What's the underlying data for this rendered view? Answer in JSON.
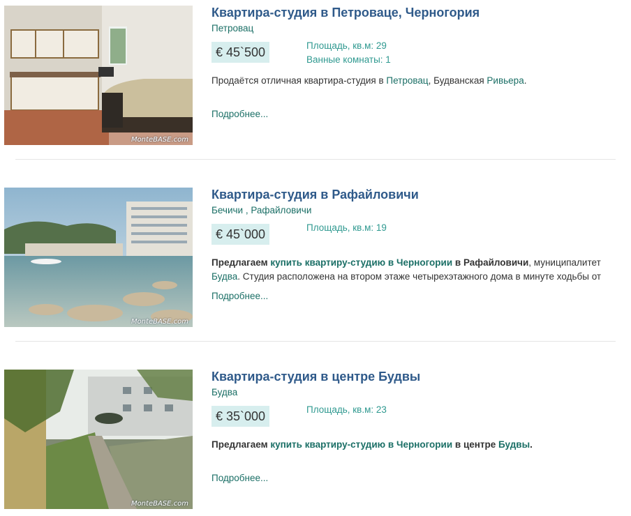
{
  "listings": [
    {
      "title": "Квартира-студия в Петроваце, Черногория",
      "location": "Петровац",
      "price": "€ 45`500",
      "specs": [
        "Площадь, кв.м: 29",
        "Ванные комнаты: 1"
      ],
      "desc_parts": [
        {
          "text": "Продаётся отличная квартира-студия в ",
          "style": "plain"
        },
        {
          "text": "Петровац",
          "style": "link"
        },
        {
          "text": ", ",
          "style": "plain"
        },
        {
          "text": "Будванская",
          "style": "plain"
        },
        {
          "text": " ",
          "style": "plain"
        },
        {
          "text": "Ривьера",
          "style": "link"
        },
        {
          "text": ".",
          "style": "plain"
        }
      ],
      "more": "Подробнее...",
      "watermark": "MonteBASE.com",
      "image_icon": "kitchen-photo"
    },
    {
      "title": "Квартира-студия в Рафайловичи",
      "location": "Бечичи , Рафайловичи",
      "price": "€ 45`000",
      "specs": [
        "Площадь, кв.м: 19"
      ],
      "desc_parts": [
        {
          "text": "Предлагаем ",
          "style": "bold"
        },
        {
          "text": "купить квартиру-студию в Черногории",
          "style": "boldlink"
        },
        {
          "text": " в Рафайловичи",
          "style": "bold"
        },
        {
          "text": ", муниципалитет ",
          "style": "plain"
        },
        {
          "text": "Будва",
          "style": "link"
        },
        {
          "text": ". Студия расположена на втором этаже четырехэтажного дома в минуте ходьбы от",
          "style": "plain"
        }
      ],
      "more": "Подробнее...",
      "watermark": "MonteBASE.com",
      "image_icon": "beach-photo"
    },
    {
      "title": "Квартира-студия в центре Будвы",
      "location": "Будва",
      "price": "€ 35`000",
      "specs": [
        "Площадь, кв.м: 23"
      ],
      "desc_parts": [
        {
          "text": "Предлагаем ",
          "style": "bold"
        },
        {
          "text": "купить квартиру-студию в Черногории",
          "style": "boldlink"
        },
        {
          "text": " в центре ",
          "style": "bold"
        },
        {
          "text": "Будвы",
          "style": "boldlink"
        },
        {
          "text": ".",
          "style": "bold"
        }
      ],
      "more": "Подробнее...",
      "watermark": "MonteBASE.com",
      "image_icon": "yard-photo"
    }
  ],
  "colors": {
    "title": "#2f5a8a",
    "link": "#1b6f66",
    "spec": "#2f9990",
    "price_bg": "#d7eeee"
  }
}
